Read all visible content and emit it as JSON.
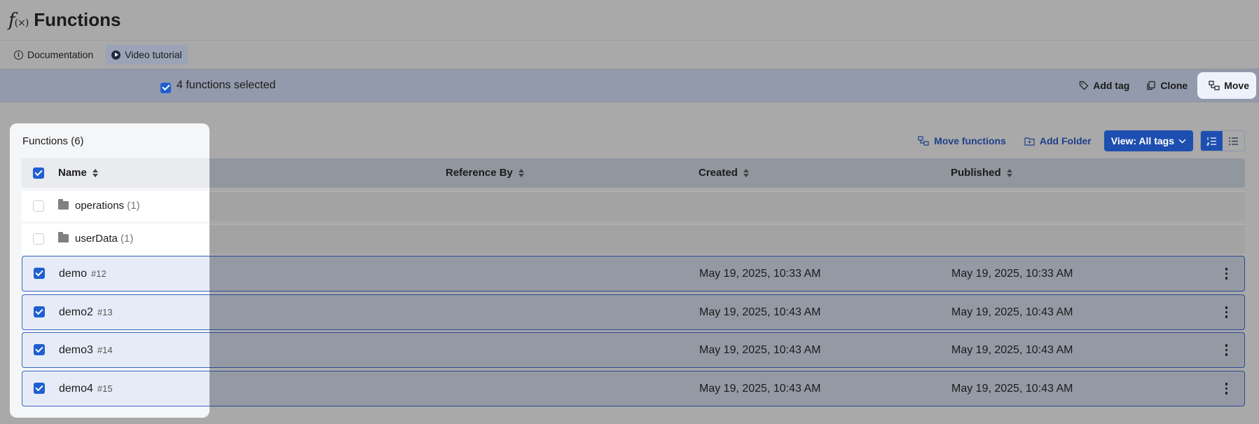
{
  "header": {
    "title": "Functions",
    "icon": "function-icon"
  },
  "links": {
    "documentation": "Documentation",
    "video_tutorial": "Video tutorial"
  },
  "selection": {
    "text": "4 functions selected",
    "actions": {
      "add_tag": "Add tag",
      "clone": "Clone",
      "move": "Move"
    }
  },
  "toolbar": {
    "move_functions": "Move functions",
    "add_folder": "Add Folder",
    "view": "View: All tags"
  },
  "panel": {
    "title": "Functions (6)"
  },
  "table": {
    "columns": {
      "name": "Name",
      "reference_by": "Reference By",
      "created": "Created",
      "published": "Published"
    },
    "folders": [
      {
        "name": "operations",
        "count": "(1)"
      },
      {
        "name": "userData",
        "count": "(1)"
      }
    ],
    "rows": [
      {
        "name": "demo",
        "id": "#12",
        "created": "May 19, 2025, 10:33 AM",
        "published": "May 19, 2025, 10:33 AM",
        "checked": true
      },
      {
        "name": "demo2",
        "id": "#13",
        "created": "May 19, 2025, 10:43 AM",
        "published": "May 19, 2025, 10:43 AM",
        "checked": true
      },
      {
        "name": "demo3",
        "id": "#14",
        "created": "May 19, 2025, 10:43 AM",
        "published": "May 19, 2025, 10:43 AM",
        "checked": true
      },
      {
        "name": "demo4",
        "id": "#15",
        "created": "May 19, 2025, 10:43 AM",
        "published": "May 19, 2025, 10:43 AM",
        "checked": true
      }
    ]
  },
  "colors": {
    "accent": "#1f5fd1",
    "primary_button": "#1e4fb0",
    "overlay": "#a9a9a9"
  }
}
